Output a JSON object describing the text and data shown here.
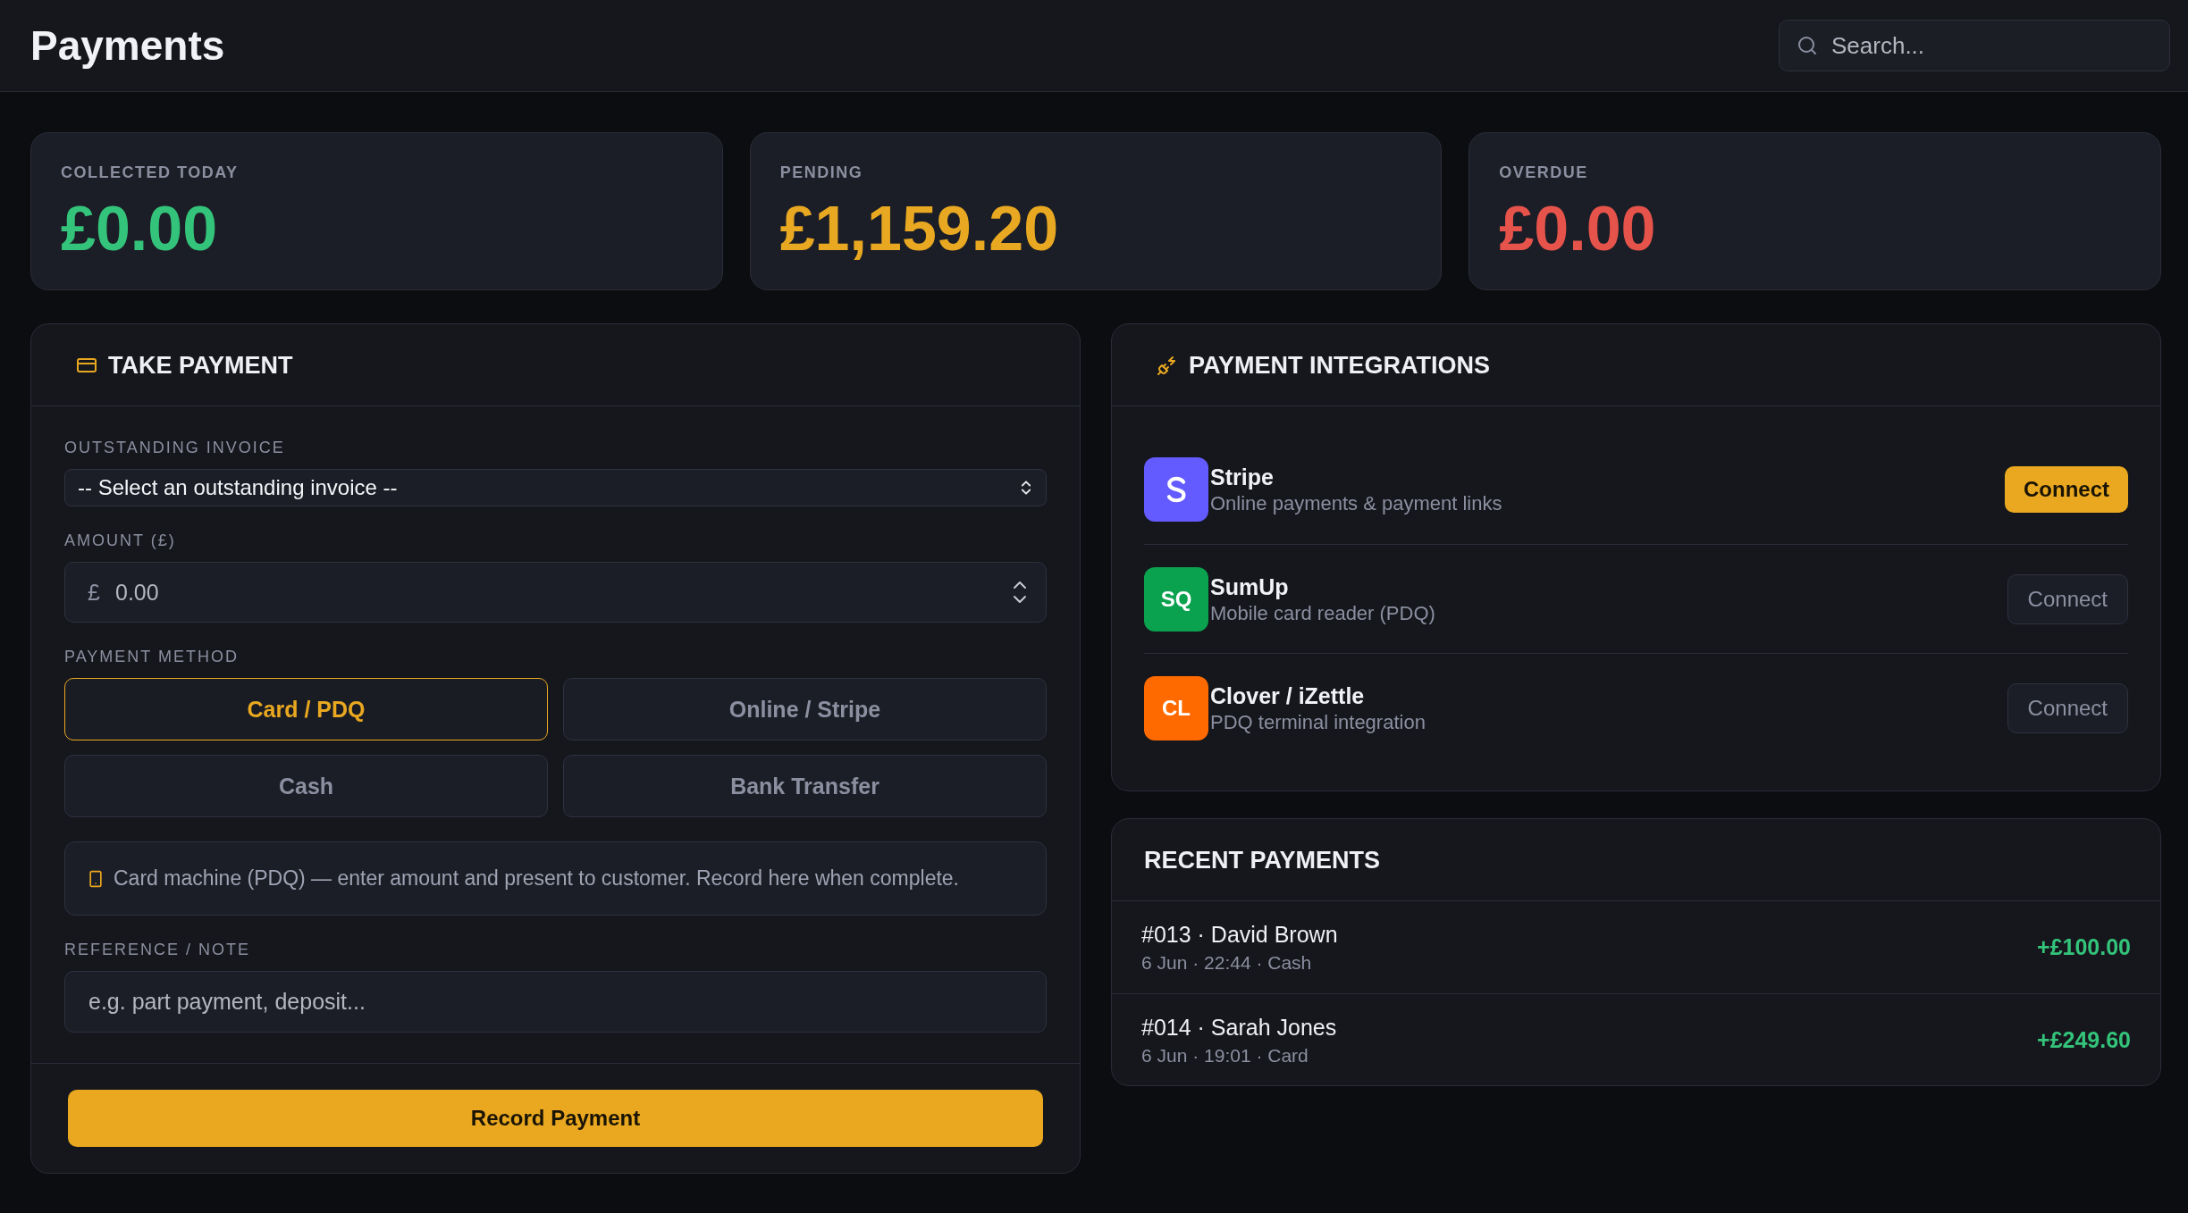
{
  "header": {
    "title": "Payments",
    "search": {
      "placeholder": "Search..."
    }
  },
  "stats": [
    {
      "label": "COLLECTED TODAY",
      "value": "£0.00",
      "color": "#34c37a"
    },
    {
      "label": "PENDING",
      "value": "£1,159.20",
      "color": "#e9a821"
    },
    {
      "label": "OVERDUE",
      "value": "£0.00",
      "color": "#e5534b"
    }
  ],
  "take_payment": {
    "title": "TAKE PAYMENT",
    "invoice": {
      "label": "OUTSTANDING INVOICE",
      "value": "-- Select an outstanding invoice --"
    },
    "amount": {
      "label": "AMOUNT (£)",
      "prefix": "£",
      "placeholder": "0.00"
    },
    "method": {
      "label": "PAYMENT METHOD",
      "options": [
        {
          "label": "Card / PDQ",
          "selected": true
        },
        {
          "label": "Online / Stripe",
          "selected": false
        },
        {
          "label": "Cash",
          "selected": false
        },
        {
          "label": "Bank Transfer",
          "selected": false
        }
      ]
    },
    "note": "Card machine (PDQ) — enter amount and present to customer. Record here when complete.",
    "reference": {
      "label": "REFERENCE / NOTE",
      "placeholder": "e.g. part payment, deposit..."
    },
    "submit": "Record Payment"
  },
  "integrations": {
    "title": "PAYMENT INTEGRATIONS",
    "items": [
      {
        "name": "Stripe",
        "description": "Online payments & payment links",
        "logo": {
          "kind": "icon"
        },
        "color": "#635bff",
        "action": {
          "label": "Connect",
          "primary": true
        }
      },
      {
        "name": "SumUp",
        "description": "Mobile card reader (PDQ)",
        "logo": {
          "kind": "text",
          "text": "SQ"
        },
        "color": "#0ba24f",
        "action": {
          "label": "Connect",
          "primary": false
        }
      },
      {
        "name": "Clover / iZettle",
        "description": "PDQ terminal integration",
        "logo": {
          "kind": "text",
          "text": "CL"
        },
        "color": "#ff6a00",
        "action": {
          "label": "Connect",
          "primary": false
        }
      }
    ]
  },
  "recent_payments": {
    "title": "RECENT PAYMENTS",
    "items": [
      {
        "title": "#013 · David Brown",
        "meta": "6 Jun · 22:44 · Cash",
        "amount": "+£100.00"
      },
      {
        "title": "#014 · Sarah Jones",
        "meta": "6 Jun · 19:01 · Card",
        "amount": "+£249.60"
      }
    ]
  }
}
